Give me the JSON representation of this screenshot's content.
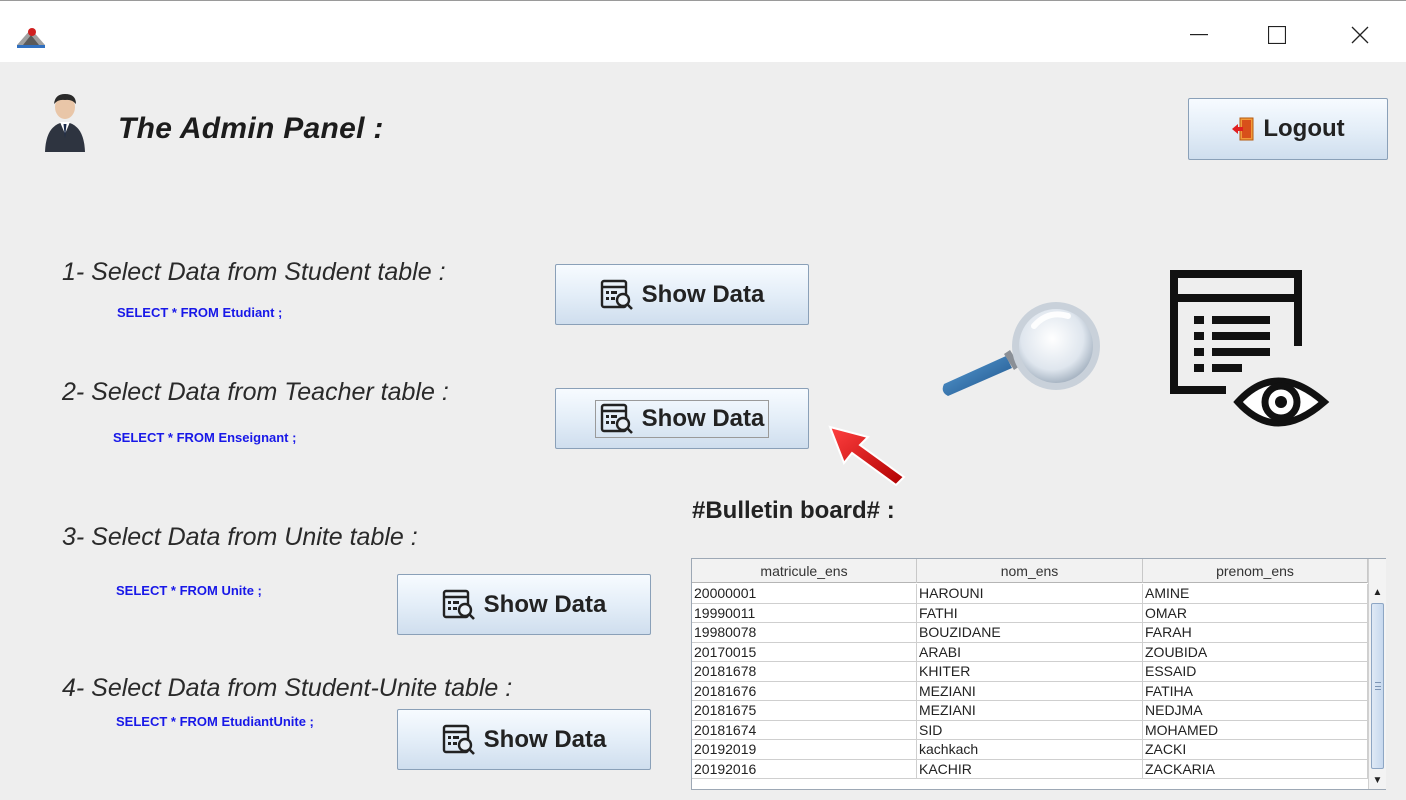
{
  "window": {
    "minimize": "—",
    "maximize": "☐",
    "close": "✕"
  },
  "header": {
    "title": "The Admin Panel  :",
    "logout_label": "Logout"
  },
  "sections": [
    {
      "label": "1- Select Data from Student table :",
      "sql": "SELECT *  FROM  Etudiant ;",
      "button": "Show Data"
    },
    {
      "label": "2- Select Data from Teacher table :",
      "sql": "SELECT * FROM Enseignant ;",
      "button": "Show Data"
    },
    {
      "label": "3- Select Data from Unite table :",
      "sql": "SELECT * FROM Unite ;",
      "button": "Show Data"
    },
    {
      "label": "4- Select Data from Student-Unite table :",
      "sql": "SELECT * FROM EtudiantUnite ;",
      "button": "Show Data"
    }
  ],
  "bulletin": {
    "title": "#Bulletin board# :",
    "columns": [
      "matricule_ens",
      "nom_ens",
      "prenom_ens"
    ],
    "rows": [
      [
        "20000001",
        "HAROUNI",
        "AMINE"
      ],
      [
        "19990011",
        "FATHI",
        "OMAR"
      ],
      [
        "19980078",
        "BOUZIDANE",
        "FARAH"
      ],
      [
        "20170015",
        "ARABI",
        "ZOUBIDA"
      ],
      [
        "20181678",
        "KHITER",
        "ESSAID"
      ],
      [
        "20181676",
        "MEZIANI",
        "FATIHA"
      ],
      [
        "20181675",
        "MEZIANI",
        "NEDJMA"
      ],
      [
        "20181674",
        "SID",
        "MOHAMED"
      ],
      [
        "20192019",
        "kachkach",
        "ZACKI"
      ],
      [
        "20192016",
        "KACHIR",
        "ZACKARIA"
      ]
    ]
  },
  "colors": {
    "sql_text": "#1818e8",
    "button_gradient_top": "#f7fbff",
    "button_gradient_bottom": "#cfdeee",
    "arrow": "#e81818"
  }
}
